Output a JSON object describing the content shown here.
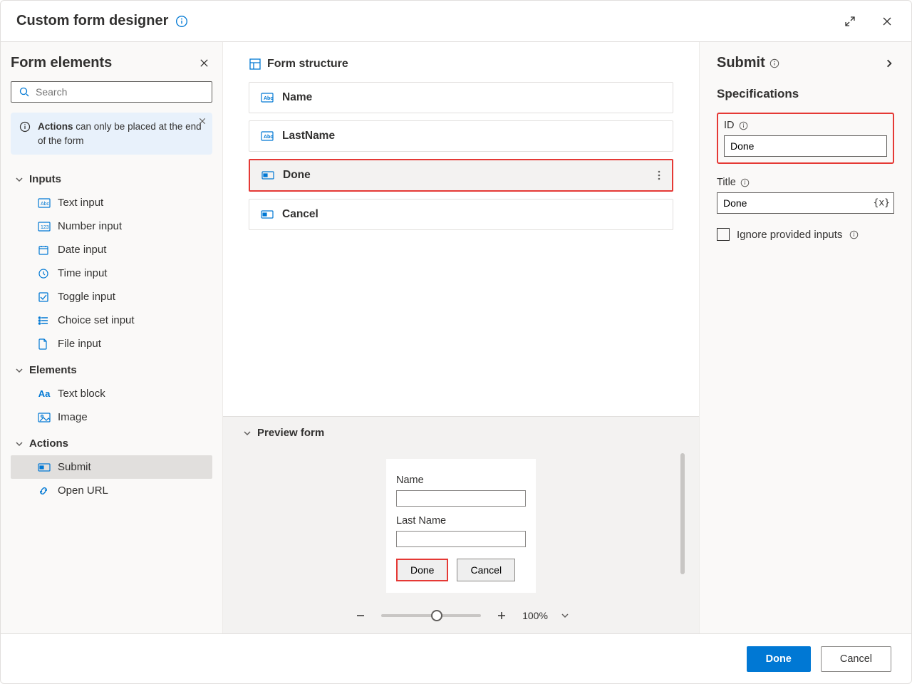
{
  "title": "Custom form designer",
  "sidebar": {
    "heading": "Form elements",
    "search_placeholder": "Search",
    "banner_strong": "Actions",
    "banner_rest": " can only be placed at the end of the form",
    "groups": {
      "inputs": {
        "label": "Inputs",
        "items": [
          "Text input",
          "Number input",
          "Date input",
          "Time input",
          "Toggle input",
          "Choice set input",
          "File input"
        ]
      },
      "elements": {
        "label": "Elements",
        "items": [
          "Text block",
          "Image"
        ]
      },
      "actions": {
        "label": "Actions",
        "items": [
          "Submit",
          "Open URL"
        ]
      }
    }
  },
  "structure": {
    "heading": "Form structure",
    "items": [
      {
        "icon": "abc",
        "label": "Name"
      },
      {
        "icon": "abc",
        "label": "LastName"
      },
      {
        "icon": "btn",
        "label": "Done",
        "selected": true
      },
      {
        "icon": "btn",
        "label": "Cancel"
      }
    ]
  },
  "preview": {
    "heading": "Preview form",
    "fields": {
      "name_label": "Name",
      "lastname_label": "Last Name"
    },
    "buttons": {
      "done": "Done",
      "cancel": "Cancel"
    },
    "zoom": "100%"
  },
  "right": {
    "heading": "Submit",
    "section": "Specifications",
    "id_label": "ID",
    "id_value": "Done",
    "title_label": "Title",
    "title_value": "Done",
    "fx_badge": "{x}",
    "ignore_label": "Ignore provided inputs"
  },
  "footer": {
    "done": "Done",
    "cancel": "Cancel"
  }
}
